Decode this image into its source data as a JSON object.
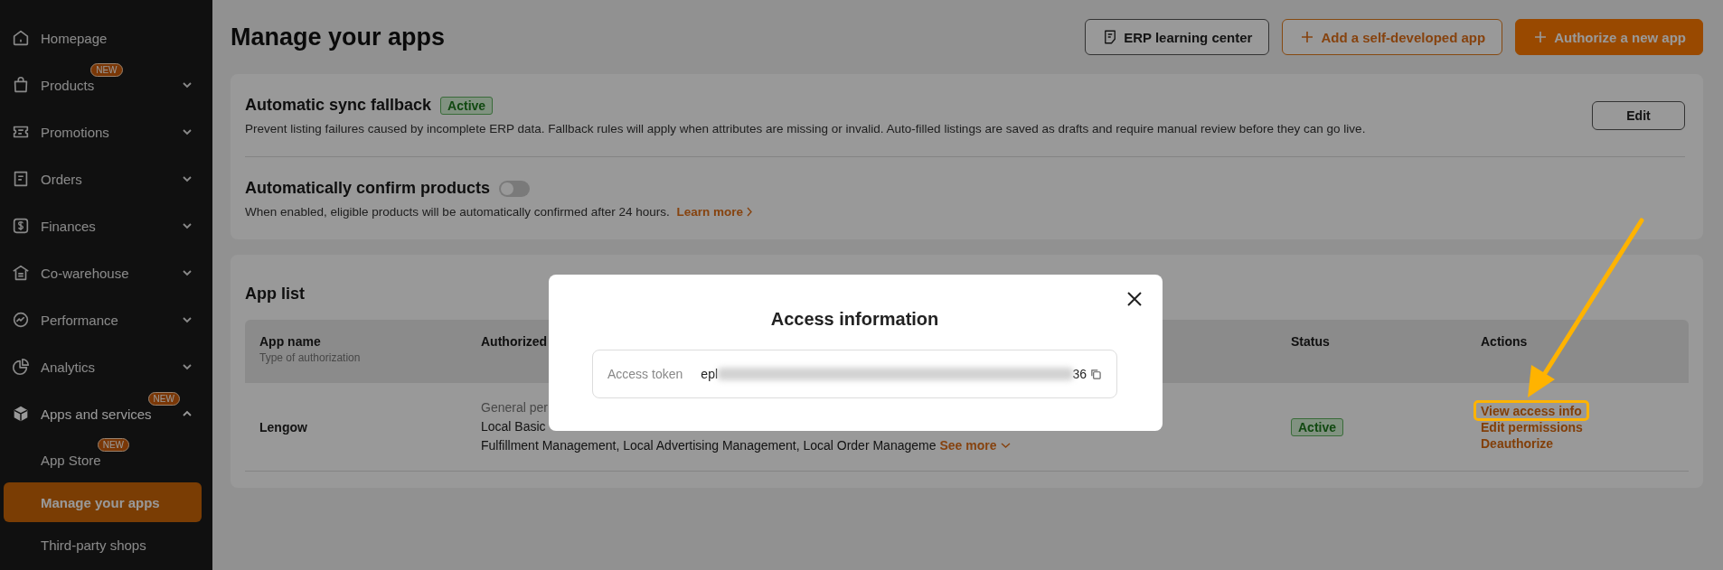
{
  "sidebar": {
    "items": [
      {
        "label": "Homepage"
      },
      {
        "label": "Products",
        "badge": "NEW",
        "expanded": false
      },
      {
        "label": "Promotions",
        "expanded": false
      },
      {
        "label": "Orders",
        "expanded": false
      },
      {
        "label": "Finances",
        "expanded": false
      },
      {
        "label": "Co-warehouse",
        "expanded": false
      },
      {
        "label": "Performance",
        "expanded": false
      },
      {
        "label": "Analytics",
        "expanded": false
      },
      {
        "label": "Apps and services",
        "badge": "NEW",
        "expanded": true,
        "children": [
          {
            "label": "App Store",
            "badge": "NEW",
            "selected": false
          },
          {
            "label": "Manage your apps",
            "selected": true
          },
          {
            "label": "Third-party shops",
            "selected": false
          }
        ]
      }
    ]
  },
  "page": {
    "title": "Manage your apps",
    "buttons": [
      {
        "label": "ERP learning center",
        "kind": "outline"
      },
      {
        "label": "Add a self-developed app",
        "kind": "accent-outline"
      },
      {
        "label": "Authorize a new app",
        "kind": "primary"
      }
    ]
  },
  "settings": [
    {
      "title": "Automatic sync fallback",
      "badge": "Active",
      "description": "Prevent listing failures caused by incomplete ERP data. Fallback rules will apply when attributes are missing or invalid. Auto-filled listings are saved as drafts and require manual review before they can go live.",
      "action": "Edit"
    },
    {
      "title": "Automatically confirm products",
      "toggle_on": false,
      "description": "When enabled, eligible products will be automatically confirmed after 24 hours.",
      "link": "Learn more"
    }
  ],
  "app_list": {
    "title": "App list",
    "columns": [
      {
        "label": "App name",
        "sublabel": "Type of authorization"
      },
      {
        "label": "Authorized"
      },
      {
        "label": "Status"
      },
      {
        "label": "Actions"
      }
    ],
    "rows": [
      {
        "app_name": "Lengow",
        "permissions_heading": "General per",
        "permissions": [
          "Local Basic",
          "Fulfillment Management, Local Advertising Management, Local Order Manageme"
        ],
        "see_more": "See more",
        "status": "Active",
        "actions": [
          {
            "label": "View access info",
            "highlighted": true
          },
          {
            "label": "Edit permissions",
            "highlighted": false
          },
          {
            "label": "Deauthorize",
            "highlighted": false
          }
        ]
      }
    ]
  },
  "modal": {
    "title": "Access information",
    "fields": [
      {
        "label": "Access token",
        "value_start": "epl",
        "value_end": "36"
      }
    ]
  }
}
